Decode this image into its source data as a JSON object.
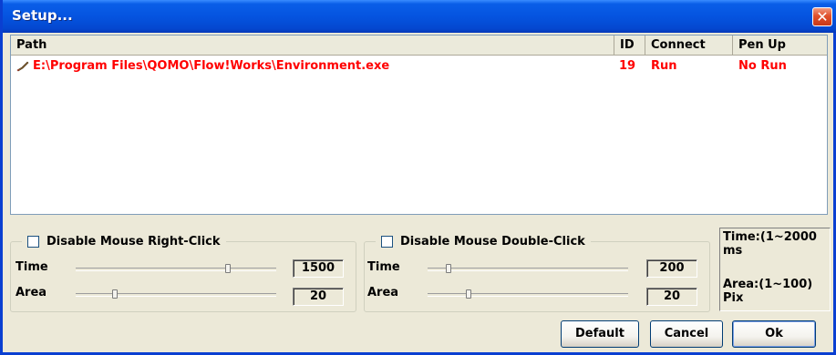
{
  "window": {
    "title": "Setup...",
    "close_symbol": "✕"
  },
  "list": {
    "columns": {
      "path": "Path",
      "id": "ID",
      "connect": "Connect",
      "pen_up": "Pen Up"
    },
    "rows": [
      {
        "icon": "app-icon",
        "path": "E:\\Program Files\\QOMO\\Flow!Works\\Environment.exe",
        "id": "19",
        "connect": "Run",
        "pen_up": "No Run"
      }
    ]
  },
  "right_click": {
    "label": "Disable Mouse Right-Click",
    "time_label": "Time",
    "area_label": "Area",
    "time_value": "1500",
    "area_value": "20"
  },
  "double_click": {
    "label": "Disable Mouse Double-Click",
    "time_label": "Time",
    "area_label": "Area",
    "time_value": "200",
    "area_value": "20"
  },
  "hint": {
    "time": "Time:(1~2000 ms",
    "area": "Area:(1~100) Pix"
  },
  "buttons": {
    "default": "Default",
    "cancel": "Cancel",
    "ok": "Ok"
  },
  "colors": {
    "row_text": "#ff0000",
    "titlebar": "#0554e0"
  }
}
